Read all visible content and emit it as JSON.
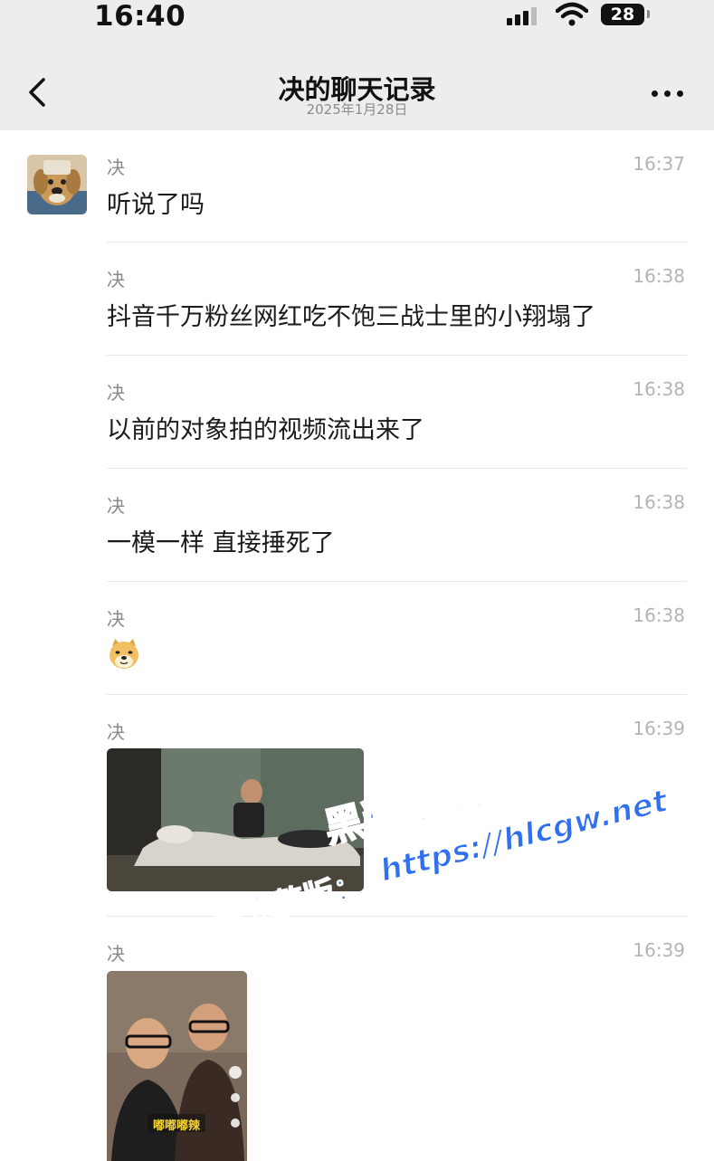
{
  "status_bar": {
    "time": "16:40",
    "battery_level": "28"
  },
  "header": {
    "title": "决的聊天记录",
    "subtitle": "2025年1月28日"
  },
  "messages": [
    {
      "sender": "决",
      "time": "16:37",
      "text": "听说了吗"
    },
    {
      "sender": "决",
      "time": "16:38",
      "text": "抖音千万粉丝网红吃不饱三战士里的小翔塌了"
    },
    {
      "sender": "决",
      "time": "16:38",
      "text": "以前的对象拍的视频流出来了"
    },
    {
      "sender": "决",
      "time": "16:38",
      "text": "一模一样 直接捶死了"
    },
    {
      "sender": "决",
      "time": "16:38",
      "emoji": "doge-emoji"
    },
    {
      "sender": "决",
      "time": "16:39",
      "media": "video"
    },
    {
      "sender": "决",
      "time": "16:39",
      "media": "video",
      "caption": "嘟嘟嘟辣"
    }
  ],
  "watermark": {
    "line1": "黑料吃瓜网",
    "line2": "https://hlcgw.net",
    "line3": "看完整版："
  },
  "colors": {
    "background": "#ffffff",
    "header_bg": "#ededed",
    "meta_text": "#8a8a8a",
    "time_text": "#b4b4b4",
    "watermark_blue": "#2f6ff0"
  }
}
